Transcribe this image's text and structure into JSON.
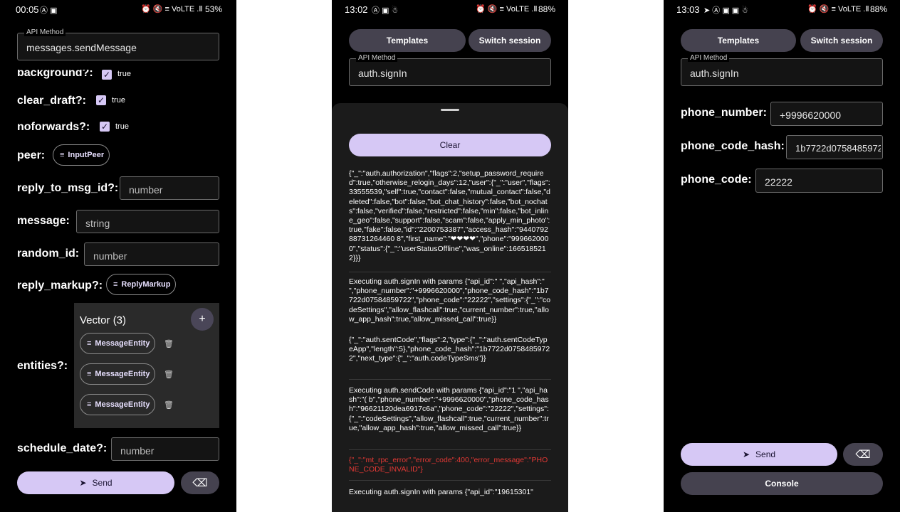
{
  "screen1": {
    "status": {
      "time": "00:05",
      "icons": "Ⓐ ▣",
      "right_icons": "⏰ 🔇 ≡ VoLTE .Ⅱ",
      "battery": "53%"
    },
    "api_method": {
      "label": "API Method",
      "value": "messages.sendMessage"
    },
    "params": {
      "background": {
        "label": "background?:",
        "value": "true"
      },
      "clear_draft": {
        "label": "clear_draft?:",
        "value": "true"
      },
      "noforwards": {
        "label": "noforwards?:",
        "value": "true"
      },
      "peer": {
        "label": "peer:",
        "chip": "InputPeer"
      },
      "reply_to_msg_id": {
        "label": "reply_to_msg_id?:",
        "placeholder": "number"
      },
      "message": {
        "label": "message:",
        "placeholder": "string"
      },
      "random_id": {
        "label": "random_id:",
        "placeholder": "number"
      },
      "reply_markup": {
        "label": "reply_markup?:",
        "chip": "ReplyMarkup"
      },
      "entities": {
        "label": "entities?:",
        "vector_title": "Vector (3)",
        "add": "+",
        "items": [
          "MessageEntity",
          "MessageEntity",
          "MessageEntity"
        ]
      },
      "schedule_date": {
        "label": "schedule_date?:",
        "placeholder": "number"
      }
    },
    "send_label": "Send",
    "send_icon": "➤",
    "clear_icon": "⌫"
  },
  "screen2": {
    "status": {
      "time": "13:02",
      "icons": "Ⓐ ▣ ☃",
      "right_icons": "⏰ 🔇 ≡ VoLTE .Ⅱ",
      "battery": "88%"
    },
    "templates_label": "Templates",
    "switch_session_label": "Switch session",
    "api_method": {
      "label": "API Method",
      "value": "auth.signIn"
    },
    "clear_label": "Clear",
    "logs": [
      "{\"_\":\"auth.authorization\",\"flags\":2,\"setup_password_required\":true,\"otherwise_relogin_days\":12,\"user\":{\"_\":\"user\",\"flags\":33555539,\"self\":true,\"contact\":false,\"mutual_contact\":false,\"deleted\":false,\"bot\":false,\"bot_chat_history\":false,\"bot_nochats\":false,\"verified\":false,\"restricted\":false,\"min\":false,\"bot_inline_geo\":false,\"support\":false,\"scam\":false,\"apply_min_photo\":true,\"fake\":false,\"id\":\"2200753387\",\"access_hash\":\"944079288731264460 8\",\"first_name\":\"❤❤❤❤\",\"phone\":\"9996620000\",\"status\":{\"_\":\"userStatusOffline\",\"was_online\":1665185212}}}",
      "Executing auth.signIn with params {\"api_id\":\"          \",\"api_hash\":\"                              \",\"phone_number\":\"+9996620000\",\"phone_code_hash\":\"1b7722d07584859722\",\"phone_code\":\"22222\",\"settings\":{\"_\":\"codeSettings\",\"allow_flashcall\":true,\"current_number\":true,\"allow_app_hash\":true,\"allow_missed_call\":true}}",
      "{\"_\":\"auth.sentCode\",\"flags\":2,\"type\":{\"_\":\"auth.sentCodeTypeApp\",\"length\":5},\"phone_code_hash\":\"1b7722d07584859722\",\"next_type\":{\"_\":\"auth.codeTypeSms\"}}",
      "Executing auth.sendCode with params {\"api_id\":\"1      \",\"api_hash\":\"(          b\",\"phone_number\":\"+9996620000\",\"phone_code_hash\":\"96621120dea6917c6a\",\"phone_code\":\"22222\",\"settings\":{\"_\":\"codeSettings\",\"allow_flashcall\":true,\"current_number\":true,\"allow_app_hash\":true,\"allow_missed_call\":true}}",
      "{\"_\":\"mt_rpc_error\",\"error_code\":400,\"error_message\":\"PHONE_CODE_INVALID\"}",
      "Executing auth.signIn with params {\"api_id\":\"19615301\""
    ]
  },
  "screen3": {
    "status": {
      "time": "13:03",
      "icons": "➤ Ⓐ ▣ ▣ ☃",
      "right_icons": "⏰ 🔇 ≡ VoLTE .Ⅱ",
      "battery": "88%"
    },
    "templates_label": "Templates",
    "switch_session_label": "Switch session",
    "api_method": {
      "label": "API Method",
      "value": "auth.signIn"
    },
    "params": {
      "phone_number": {
        "label": "phone_number:",
        "value": "+9996620000"
      },
      "phone_code_hash": {
        "label": "phone_code_hash:",
        "value": "1b7722d0758485972"
      },
      "phone_code": {
        "label": "phone_code:",
        "value": "22222"
      }
    },
    "send_label": "Send",
    "send_icon": "➤",
    "clear_icon": "⌫",
    "console_label": "Console"
  },
  "colors": {
    "accent": "#d6c8f5",
    "dark_button": "#45424f",
    "error": "#e53935",
    "background": "#000000"
  }
}
